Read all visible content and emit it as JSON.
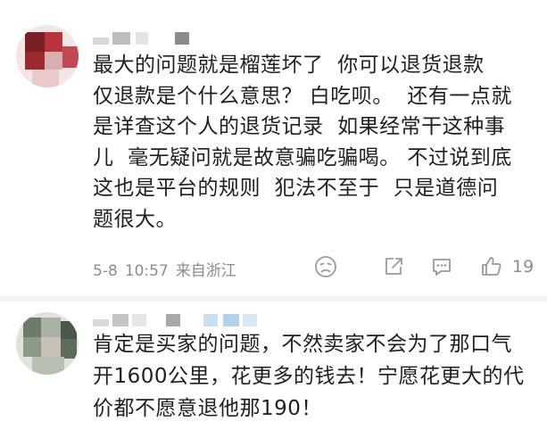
{
  "comments": [
    {
      "body": "最大的问题就是榴莲坏了  你可以退货退款\n仅退款是个什么意思？ 白吃呗。  还有一点就\n是详查这个人的退货记录  如果经常干这种事\n儿  毫无疑问就是故意骗吃骗喝。 不过说到底\n这也是平台的规则  犯法不至于  只是道德问\n题很大。",
      "date": "5-8",
      "time": "10:57",
      "location": "来自浙江",
      "like_count": "19",
      "actions": [
        "dislike-icon",
        "share-icon",
        "comment-icon",
        "like-icon"
      ]
    },
    {
      "body": "肯定是买家的问题，不然卖家不会为了那口气\n开1600公里，花更多的钱去！宁愿花更大的代\n价都不愿意退他那190！"
    }
  ]
}
